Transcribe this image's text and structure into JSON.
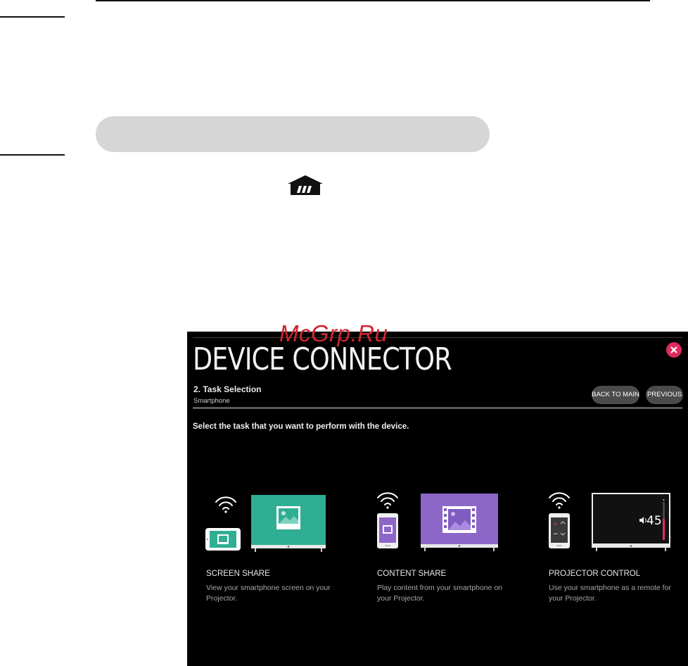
{
  "watermark": "McGrp.Ru",
  "dialog": {
    "title": "DEVICE CONNECTOR",
    "step": "2. Task Selection",
    "device": "Smartphone",
    "back_label": "BACK TO MAIN",
    "previous_label": "PREVIOUS",
    "instruction": "Select the task that you want to perform with the device.",
    "volume_readout": "45",
    "tasks": [
      {
        "title": "SCREEN SHARE",
        "desc": "View your smartphone screen on your Projector."
      },
      {
        "title": "CONTENT SHARE",
        "desc": "Play content from your smartphone on your Projector."
      },
      {
        "title": "PROJECTOR CONTROL",
        "desc": "Use your smartphone as a remote for your Projector."
      }
    ]
  },
  "icons": {
    "home": "home-icon",
    "close": "close-icon",
    "wifi": "wifi-icon",
    "image": "image-icon",
    "film": "film-icon",
    "volume": "volume-icon"
  },
  "colors": {
    "accent_close": "#e02a5b",
    "screen_share_teal": "#2fae93",
    "content_share_purple": "#8c67c8",
    "volume_bar": "#e02a5b"
  }
}
